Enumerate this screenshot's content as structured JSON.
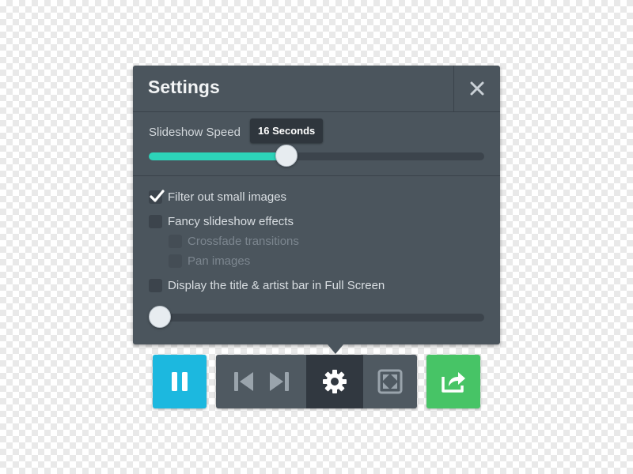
{
  "settings": {
    "title": "Settings",
    "close_icon": "close-icon",
    "speed": {
      "label": "Slideshow Speed",
      "value_text": "16 Seconds",
      "fraction": 0.41
    },
    "options": [
      {
        "label": "Filter out small images",
        "checked": true,
        "enabled": true
      },
      {
        "label": "Fancy slideshow effects",
        "checked": false,
        "enabled": true
      },
      {
        "label": "Crossfade transitions",
        "checked": false,
        "enabled": false
      },
      {
        "label": "Pan images",
        "checked": false,
        "enabled": false
      },
      {
        "label": "Display the title & artist bar in Full Screen",
        "checked": false,
        "enabled": true
      }
    ],
    "second_slider": {
      "fraction": 0.0
    }
  },
  "controls": {
    "pause_icon": "pause-icon",
    "prev_icon": "skip-previous-icon",
    "next_icon": "skip-next-icon",
    "settings_icon": "gear-icon",
    "fullscreen_icon": "fullscreen-icon",
    "share_icon": "share-icon"
  },
  "colors": {
    "panel": "#4b555d",
    "accent_slider": "#2dd3b9",
    "pause_button": "#1cb8df",
    "share_button": "#47c466",
    "active_button": "#313840"
  }
}
